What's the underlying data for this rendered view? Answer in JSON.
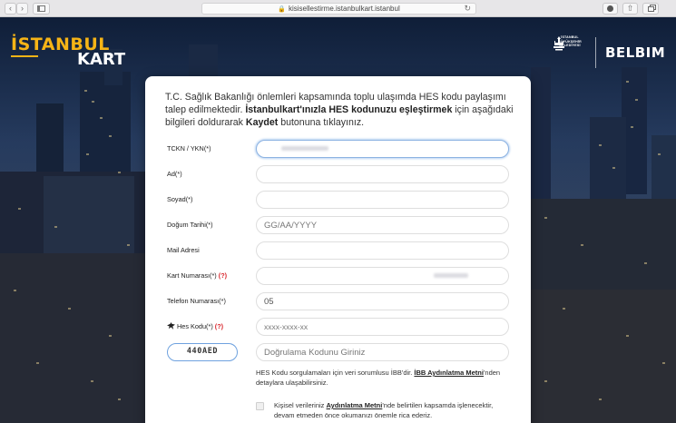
{
  "browser": {
    "url": "kisisellestirme.istanbulkart.istanbul"
  },
  "brand": {
    "logo_top": "İSTANBUL",
    "logo_bottom": "KART",
    "ibb_lines": [
      "İSTANBUL",
      "BÜYÜKŞEHİR",
      "BELEDİYESİ"
    ],
    "partner": "BELBIM",
    "accent": "#f6b416"
  },
  "form": {
    "intro_1": "T.C. Sağlık Bakanlığı önlemleri kapsamında toplu ulaşımda HES kodu paylaşımı talep edilmektedir. ",
    "intro_bold": "İstanbulkart'ınızla HES kodunuzu eşleştirmek",
    "intro_2": " için aşağıdaki bilgileri doldurarak ",
    "intro_bold_2": "Kaydet",
    "intro_3": " butonuna tıklayınız.",
    "fields": [
      {
        "label": "TCKN / YKN(*)",
        "value": "",
        "placeholder": ""
      },
      {
        "label": "Ad(*)",
        "value": "",
        "placeholder": ""
      },
      {
        "label": "Soyad(*)",
        "value": "",
        "placeholder": ""
      },
      {
        "label": "Doğum Tarihi(*)",
        "value": "",
        "placeholder": "GG/AA/YYYY"
      },
      {
        "label": "Mail Adresi",
        "value": "",
        "placeholder": ""
      },
      {
        "label": "Kart Numarası(*)",
        "value": "",
        "placeholder": "",
        "help": "(?)"
      },
      {
        "label": "Telefon Numarası(*)",
        "value": "05",
        "placeholder": ""
      },
      {
        "label": "Hes Kodu(*)",
        "value": "",
        "placeholder": "xxxx-xxxx-xx",
        "help": "(?)"
      }
    ],
    "captcha": {
      "code": "440AED",
      "placeholder": "Doğrulama Kodunu Giriniz"
    },
    "note_1": "HES Kodu sorgulamaları için veri sorumlusu İBB'dir. ",
    "note_link": "İBB Aydınlatma Metni",
    "note_2": "'nden detaylara ulaşabilirsiniz.",
    "consent_1": "Kişisel verileriniz ",
    "consent_link": "Aydınlatma Metni",
    "consent_2": "'nde belirtilen kapsamda işlenecektir, devam etmeden önce okumanızı önemle rica ederiz."
  }
}
